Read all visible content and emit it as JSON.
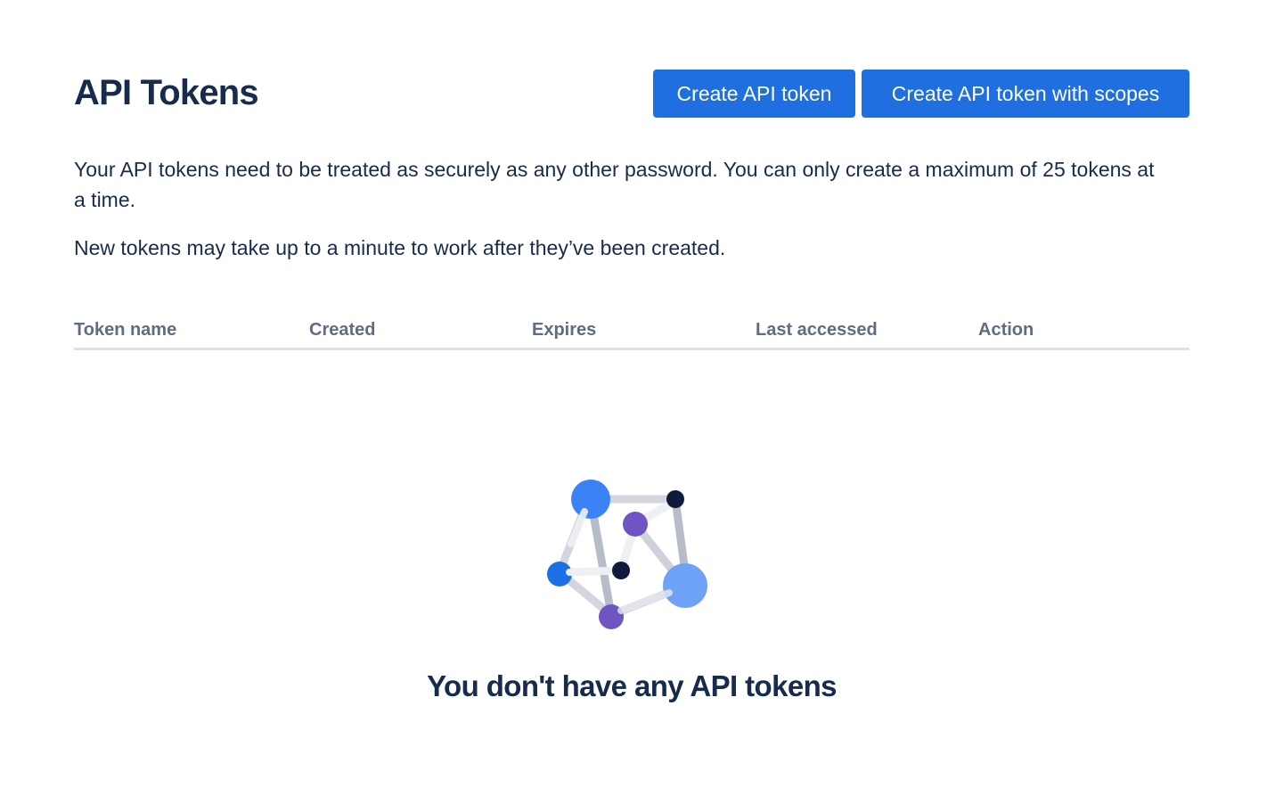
{
  "header": {
    "title": "API Tokens",
    "create_button_label": "Create API token",
    "create_scopes_button_label": "Create API token with scopes"
  },
  "description": {
    "paragraph1": "Your API tokens need to be treated as securely as any other password. You can only create a maximum of 25 tokens at a time.",
    "paragraph2": "New tokens may take up to a minute to work after they’ve been created."
  },
  "table": {
    "columns": [
      "Token name",
      "Created",
      "Expires",
      "Last accessed",
      "Action"
    ]
  },
  "empty_state": {
    "illustration": "network-graph-illustration",
    "title": "You don't have any API tokens"
  },
  "colors": {
    "primary_button": "#1f6fe0",
    "heading_text": "#172b4d",
    "column_header_text": "#5e6c84",
    "divider": "#dfe1e6"
  }
}
